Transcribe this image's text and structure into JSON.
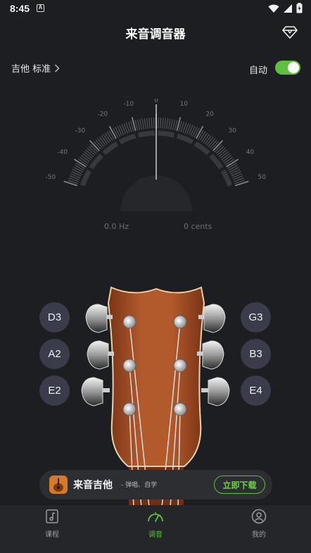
{
  "status_bar": {
    "time": "8:45",
    "notification_icon": "A"
  },
  "header": {
    "title": "来音调音器",
    "vip_icon": "diamond-icon"
  },
  "controls": {
    "instrument": "吉他 标准",
    "auto_label": "自动",
    "auto_enabled": true
  },
  "gauge": {
    "scale_labels": [
      "-50",
      "-40",
      "-30",
      "-20",
      "-10",
      "0",
      "10",
      "20",
      "30",
      "40",
      "50"
    ],
    "needle_cents": 0
  },
  "readout": {
    "frequency": "0.0 Hz",
    "cents": "0 cents"
  },
  "strings": {
    "left": [
      "D3",
      "A2",
      "E2"
    ],
    "right": [
      "G3",
      "B3",
      "E4"
    ]
  },
  "promo": {
    "app_name": "来音吉他",
    "subtitle": "- 弹唱、自学",
    "button": "立即下载"
  },
  "bottom_nav": [
    {
      "label": "课程",
      "icon": "music-note-book-icon",
      "active": false
    },
    {
      "label": "调音",
      "icon": "tuner-gauge-icon",
      "active": true
    },
    {
      "label": "我的",
      "icon": "profile-icon",
      "active": false
    }
  ],
  "colors": {
    "background": "#1d1e21",
    "accent": "#5fbf3f",
    "string_button": "#3a3c4c",
    "headstock_wood": "#a8502a"
  }
}
